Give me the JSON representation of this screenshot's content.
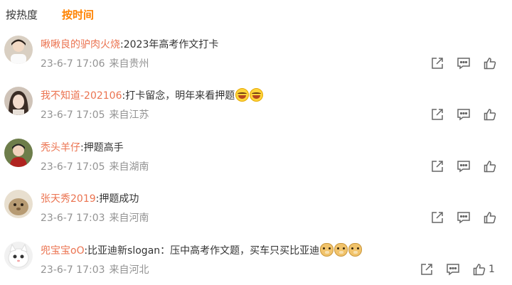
{
  "sort_tabs": [
    {
      "label": "按热度",
      "active": false
    },
    {
      "label": "按时间",
      "active": true
    }
  ],
  "comments": [
    {
      "username": "啾啾良的驴肉火烧",
      "text": ":2023年高考作文打卡",
      "emojis": [],
      "time": "23-6-7 17:06",
      "location": "来自贵州",
      "likes": ""
    },
    {
      "username": "我不知道-202106",
      "text": ":打卡留念，明年来看押题",
      "emojis": [
        "laugh",
        "laugh"
      ],
      "time": "23-6-7 17:05",
      "location": "来自江苏",
      "likes": ""
    },
    {
      "username": "秃头羊仔",
      "text": ":押题高手",
      "emojis": [],
      "time": "23-6-7 17:05",
      "location": "来自湖南",
      "likes": ""
    },
    {
      "username": "张天秀2019",
      "text": ":押题成功",
      "emojis": [],
      "time": "23-6-7 17:03",
      "location": "来自河南",
      "likes": ""
    },
    {
      "username": "兜宝宝oO",
      "text": ":比亚迪新slogan：压中高考作文题，买车只买比亚迪",
      "emojis": [
        "doge",
        "doge",
        "doge"
      ],
      "time": "23-6-7 17:03",
      "location": "来自河北",
      "likes": "1"
    }
  ],
  "icons": {
    "share": "share-icon",
    "comment": "comment-icon",
    "like": "thumbs-up-icon"
  },
  "colors": {
    "accent": "#ff8200",
    "username": "#eb7350",
    "meta": "#939393"
  }
}
